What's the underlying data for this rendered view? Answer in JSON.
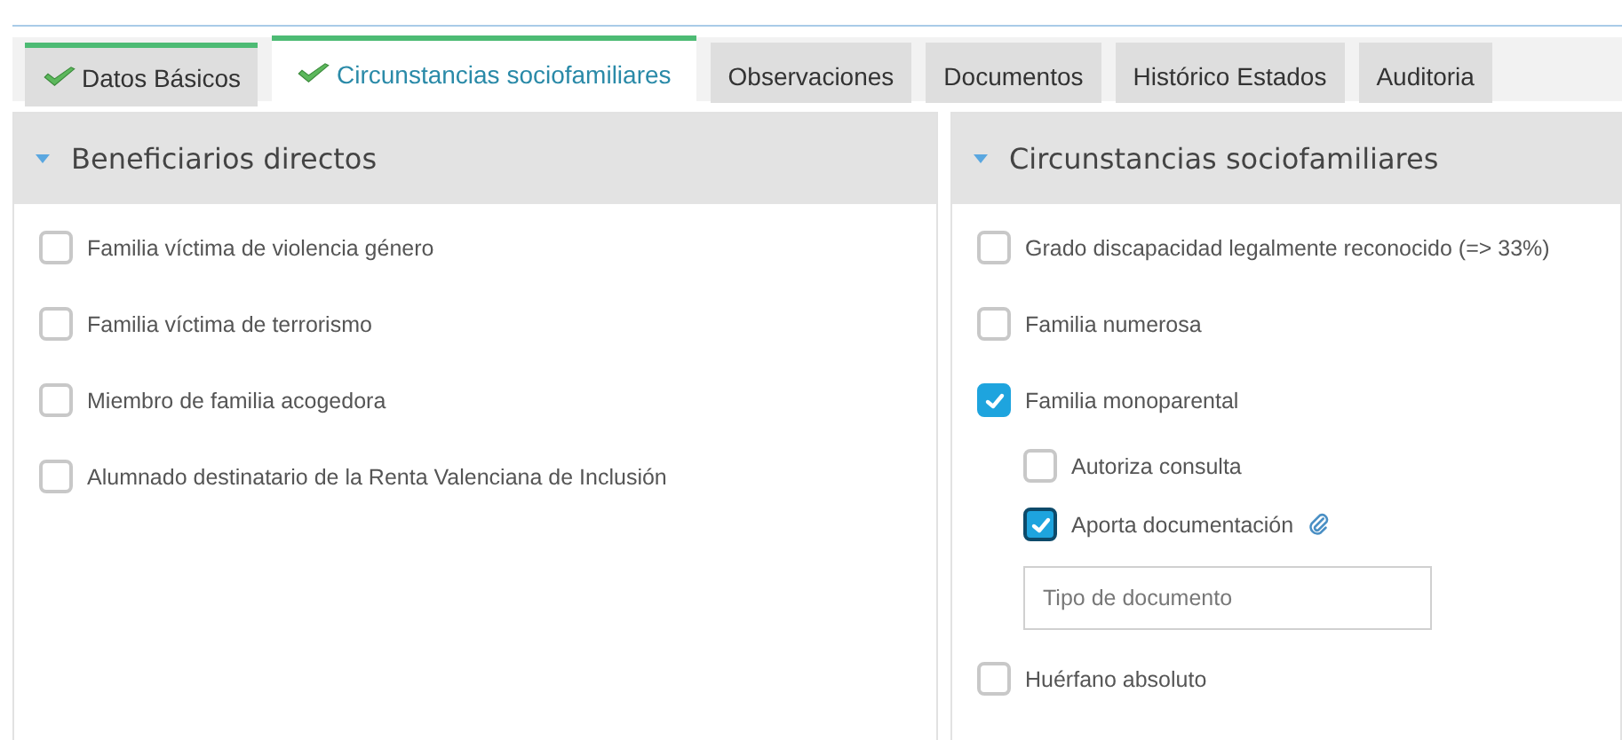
{
  "tabs": [
    {
      "label": "Datos Básicos",
      "selected": false,
      "completed": true
    },
    {
      "label": "Circunstancias sociofamiliares",
      "selected": true,
      "completed": true
    },
    {
      "label": "Observaciones",
      "selected": false,
      "completed": false
    },
    {
      "label": "Documentos",
      "selected": false,
      "completed": false
    },
    {
      "label": "Histórico Estados",
      "selected": false,
      "completed": false
    },
    {
      "label": "Auditoria",
      "selected": false,
      "completed": false
    }
  ],
  "panels": [
    {
      "title": "Beneficiarios directos",
      "expanded": true,
      "items": [
        {
          "kind": "checkbox",
          "label": "Familia víctima de violencia género",
          "checked": false
        },
        {
          "kind": "checkbox",
          "label": "Familia víctima de terrorismo",
          "checked": false
        },
        {
          "kind": "checkbox",
          "label": "Miembro de familia acogedora",
          "checked": false
        },
        {
          "kind": "checkbox",
          "label": "Alumnado destinatario de la Renta Valenciana de Inclusión",
          "checked": false
        }
      ]
    },
    {
      "title": "Circunstancias sociofamiliares",
      "expanded": true,
      "items": [
        {
          "kind": "checkbox",
          "label": "Grado discapacidad legalmente reconocido (=> 33%)",
          "checked": false
        },
        {
          "kind": "checkbox",
          "label": "Familia numerosa",
          "checked": false
        },
        {
          "kind": "checkbox",
          "label": "Familia monoparental",
          "checked": true,
          "children": [
            {
              "kind": "checkbox",
              "label": "Autoriza consulta",
              "checked": false
            },
            {
              "kind": "checkbox",
              "label": "Aporta documentación",
              "checked": true,
              "focused": true,
              "attachment": true
            },
            {
              "kind": "field",
              "placeholder": "Tipo de documento"
            }
          ]
        },
        {
          "kind": "checkbox",
          "label": "Huérfano absoluto",
          "checked": false
        }
      ]
    }
  ]
}
